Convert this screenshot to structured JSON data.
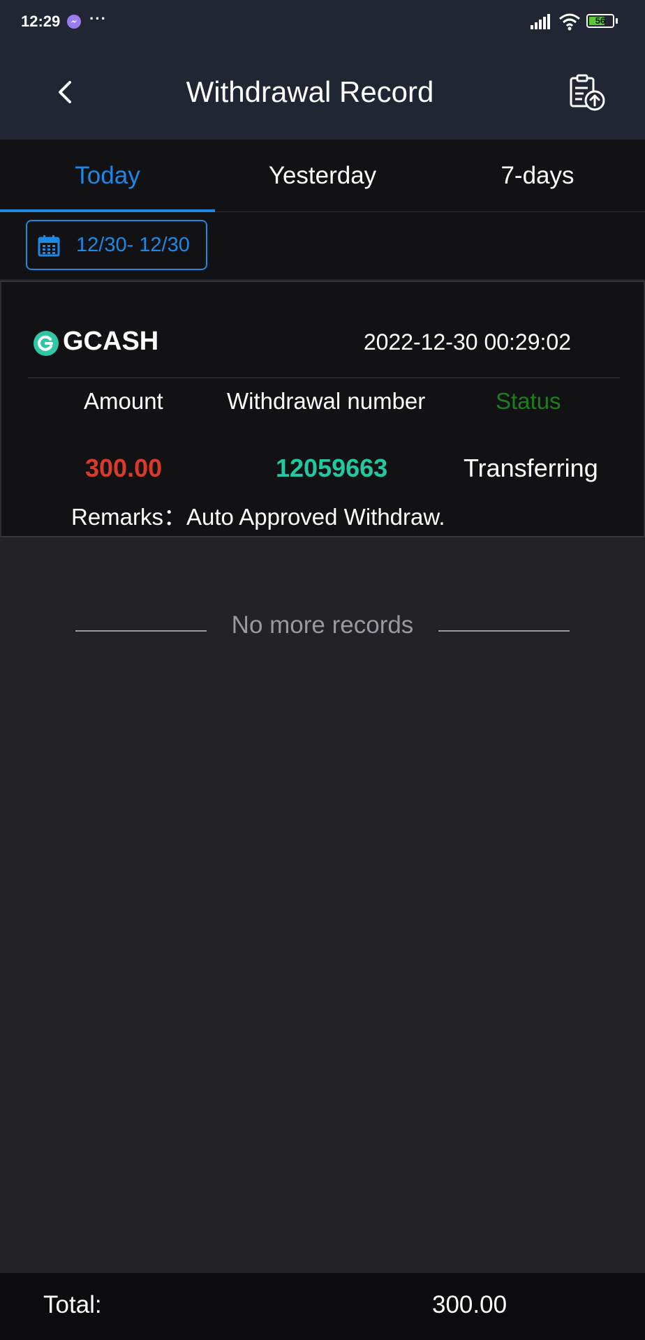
{
  "status_bar": {
    "time": "12:29",
    "dots": "···",
    "battery_level": "56"
  },
  "header": {
    "title": "Withdrawal Record",
    "back_icon": "chevron-left-icon",
    "upload_icon": "clipboard-upload-icon"
  },
  "tabs": [
    {
      "label": "Today",
      "active": true
    },
    {
      "label": "Yesterday",
      "active": false
    },
    {
      "label": "7-days",
      "active": false
    }
  ],
  "date_filter": {
    "range": "12/30- 12/30",
    "icon": "calendar-icon"
  },
  "records": [
    {
      "method": "GCASH",
      "datetime": "2022-12-30 00:29:02",
      "amount_label": "Amount",
      "number_label": "Withdrawal number",
      "status_label": "Status",
      "amount": "300.00",
      "number": "12059663",
      "status": "Transferring",
      "remarks": "Remarks：Auto Approved Withdraw."
    }
  ],
  "no_more": "No more records",
  "footer": {
    "total_label": "Total:",
    "total_value": "300.00"
  },
  "colors": {
    "accent": "#1e88e5",
    "amount": "#d93a2b",
    "number": "#21c9a1",
    "status_header": "#1c7d1c"
  }
}
